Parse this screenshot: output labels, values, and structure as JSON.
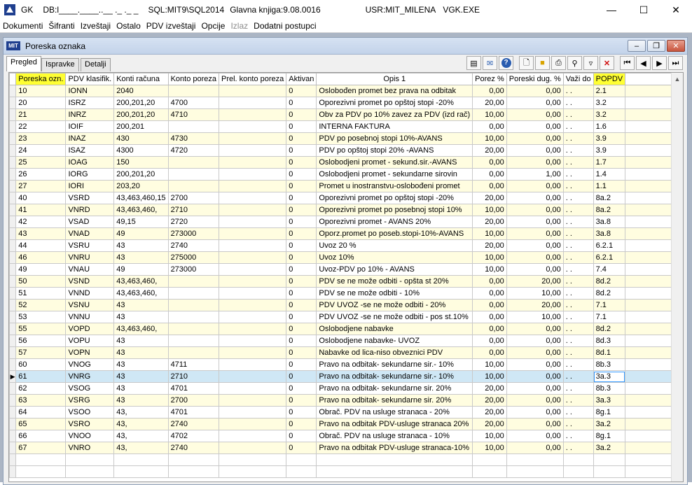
{
  "titlebar": {
    "app": "GK",
    "db": "DB:l____.____..__ ._ ._ _",
    "sql": "SQL:MIT9\\SQL2014",
    "book": "Glavna knjiga:9.08.0016",
    "user": "USR:MIT_MILENA",
    "exe": "VGK.EXE",
    "minimize_icon": "minimize-icon",
    "maximize_icon": "maximize-icon",
    "close_icon": "close-icon"
  },
  "menu": [
    "Dokumenti",
    "Šifranti",
    "Izveštaji",
    "Ostalo",
    "PDV izveštaji",
    "Opcije",
    "Izlaz",
    "Dodatni postupci"
  ],
  "menu_disabled": [
    "Izlaz"
  ],
  "child": {
    "logo": "MIT",
    "title": "Poreska oznaka"
  },
  "tabs": [
    "Pregled",
    "Ispravke",
    "Detalji"
  ],
  "active_tab": "Pregled",
  "toolbar": [
    "export-icon",
    "mail-icon",
    "help-icon",
    "new-icon",
    "open-icon",
    "print-icon",
    "search-icon",
    "filter-icon",
    "delete-icon",
    "first-icon",
    "prev-icon",
    "next-icon",
    "last-icon"
  ],
  "columns": [
    "Poreska ozn.",
    "PDV klasifik.",
    "Konti računa",
    "Konto poreza",
    "Prel. konto poreza",
    "Aktivan",
    "Opis 1",
    "Porez %",
    "Poreski dug. %",
    "Važi do",
    "POPDV"
  ],
  "highlight_color": "#ffff33",
  "selected_row": "61",
  "rows": [
    [
      "10",
      "IONN",
      "2040",
      "",
      "",
      "0",
      "Oslobođen promet bez prava na odbitak",
      "0,00",
      "0,00",
      ". .",
      "2.1"
    ],
    [
      "20",
      "ISRZ",
      "200,201,20",
      "4700",
      "",
      "0",
      "Oporezivni promet po opštoj stopi -20%",
      "20,00",
      "0,00",
      ". .",
      "3.2"
    ],
    [
      "21",
      "INRZ",
      "200,201,20",
      "4710",
      "",
      "0",
      "Obv za PDV po 10% zavez za PDV (izd rač)",
      "10,00",
      "0,00",
      ". .",
      "3.2"
    ],
    [
      "22",
      "IOIF",
      "200,201",
      "",
      "",
      "0",
      "INTERNA FAKTURA",
      "0,00",
      "0,00",
      ". .",
      "1.6"
    ],
    [
      "23",
      "INAZ",
      "430",
      "4730",
      "",
      "0",
      "PDV po posebnoj stopi 10%-AVANS",
      "10,00",
      "0,00",
      ". .",
      "3.9"
    ],
    [
      "24",
      "ISAZ",
      "4300",
      "4720",
      "",
      "0",
      "PDV po opštoj stopi 20% -AVANS",
      "20,00",
      "0,00",
      ". .",
      "3.9"
    ],
    [
      "25",
      "IOAG",
      "150",
      "",
      "",
      "0",
      "Oslobodjeni promet - sekund.sir.-AVANS",
      "0,00",
      "0,00",
      ". .",
      "1.7"
    ],
    [
      "26",
      "IORG",
      "200,201,20",
      "",
      "",
      "0",
      "Oslobodjeni promet - sekundarne sirovin",
      "0,00",
      "1,00",
      ". .",
      "1.4"
    ],
    [
      "27",
      "IORI",
      "203,20",
      "",
      "",
      "0",
      "Promet u inostranstvu-oslobođeni promet",
      "0,00",
      "0,00",
      ". .",
      "1.1"
    ],
    [
      "40",
      "VSRD",
      "43,463,460,15",
      "2700",
      "",
      "0",
      "Oporezivni promet po opštoj stopi -20%",
      "20,00",
      "0,00",
      ". .",
      "8a.2"
    ],
    [
      "41",
      "VNRD",
      "43,463,460,",
      "2710",
      "",
      "0",
      "Oporezivni promet po posebnoj stopi 10%",
      "10,00",
      "0,00",
      ". .",
      "8a.2"
    ],
    [
      "42",
      "VSAD",
      "49,15",
      "2720",
      "",
      "0",
      "Oporezivni promet - AVANS 20%",
      "20,00",
      "0,00",
      ". .",
      "3a.8"
    ],
    [
      "43",
      "VNAD",
      "49",
      "273000",
      "",
      "0",
      "Oporz.promet po poseb.stopi-10%-AVANS",
      "10,00",
      "0,00",
      ". .",
      "3a.8"
    ],
    [
      "44",
      "VSRU",
      "43",
      "2740",
      "",
      "0",
      "Uvoz 20 %",
      "20,00",
      "0,00",
      ". .",
      "6.2.1"
    ],
    [
      "46",
      "VNRU",
      "43",
      "275000",
      "",
      "0",
      "Uvoz 10%",
      "10,00",
      "0,00",
      ". .",
      "6.2.1"
    ],
    [
      "49",
      "VNAU",
      "49",
      "273000",
      "",
      "0",
      "Uvoz-PDV po 10% - AVANS",
      "10,00",
      "0,00",
      ". .",
      "7.4"
    ],
    [
      "50",
      "VSND",
      "43,463,460,",
      "",
      "",
      "0",
      "PDV se ne može odbiti - opšta st 20%",
      "0,00",
      "20,00",
      ". .",
      "8d.2"
    ],
    [
      "51",
      "VNND",
      "43,463,460,",
      "",
      "",
      "0",
      "PDV se ne može odbiti - 10%",
      "0,00",
      "10,00",
      ". .",
      "8d.2"
    ],
    [
      "52",
      "VSNU",
      "43",
      "",
      "",
      "0",
      "PDV UVOZ -se ne može odbiti - 20%",
      "0,00",
      "20,00",
      ". .",
      "7.1"
    ],
    [
      "53",
      "VNNU",
      "43",
      "",
      "",
      "0",
      "PDV UVOZ -se ne može odbiti - pos st.10%",
      "0,00",
      "10,00",
      ". .",
      "7.1"
    ],
    [
      "55",
      "VOPD",
      "43,463,460,",
      "",
      "",
      "0",
      "Oslobodjene nabavke",
      "0,00",
      "0,00",
      ". .",
      "8d.2"
    ],
    [
      "56",
      "VOPU",
      "43",
      "",
      "",
      "0",
      "Oslobodjene nabavke- UVOZ",
      "0,00",
      "0,00",
      ". .",
      "8d.3"
    ],
    [
      "57",
      "VOPN",
      "43",
      "",
      "",
      "0",
      "Nabavke od lica-niso obveznici PDV",
      "0,00",
      "0,00",
      ". .",
      "8d.1"
    ],
    [
      "60",
      "VNOG",
      "43",
      "4711",
      "",
      "0",
      "Pravo na odbitak- sekundarne sir.- 10%",
      "10,00",
      "0,00",
      ". .",
      "8b.3"
    ],
    [
      "61",
      "VNRG",
      "43",
      "2710",
      "",
      "0",
      "Pravo na odbitak- sekundarne sir.- 10%",
      "10,00",
      "0,00",
      ". .",
      "3a.3"
    ],
    [
      "62",
      "VSOG",
      "43",
      "4701",
      "",
      "0",
      "Pravo na odbitak- sekundarne sir. 20%",
      "20,00",
      "0,00",
      ". .",
      "8b.3"
    ],
    [
      "63",
      "VSRG",
      "43",
      "2700",
      "",
      "0",
      "Pravo na odbitak- sekundarne sir. 20%",
      "20,00",
      "0,00",
      ". .",
      "3a.3"
    ],
    [
      "64",
      "VSOO",
      "43,",
      "4701",
      "",
      "0",
      "Obrač. PDV na usluge stranaca - 20%",
      "20,00",
      "0,00",
      ". .",
      "8g.1"
    ],
    [
      "65",
      "VSRO",
      "43,",
      "2740",
      "",
      "0",
      "Pravo na odbitak PDV-usluge stranaca 20%",
      "20,00",
      "0,00",
      ". .",
      "3a.2"
    ],
    [
      "66",
      "VNOO",
      "43,",
      "4702",
      "",
      "0",
      "Obrač. PDV na usluge stranaca - 10%",
      "10,00",
      "0,00",
      ". .",
      "8g.1"
    ],
    [
      "67",
      "VNRO",
      "43,",
      "2740",
      "",
      "0",
      "Pravo na odbitak PDV-usluge stranaca-10%",
      "10,00",
      "0,00",
      ". .",
      "3a.2"
    ]
  ]
}
